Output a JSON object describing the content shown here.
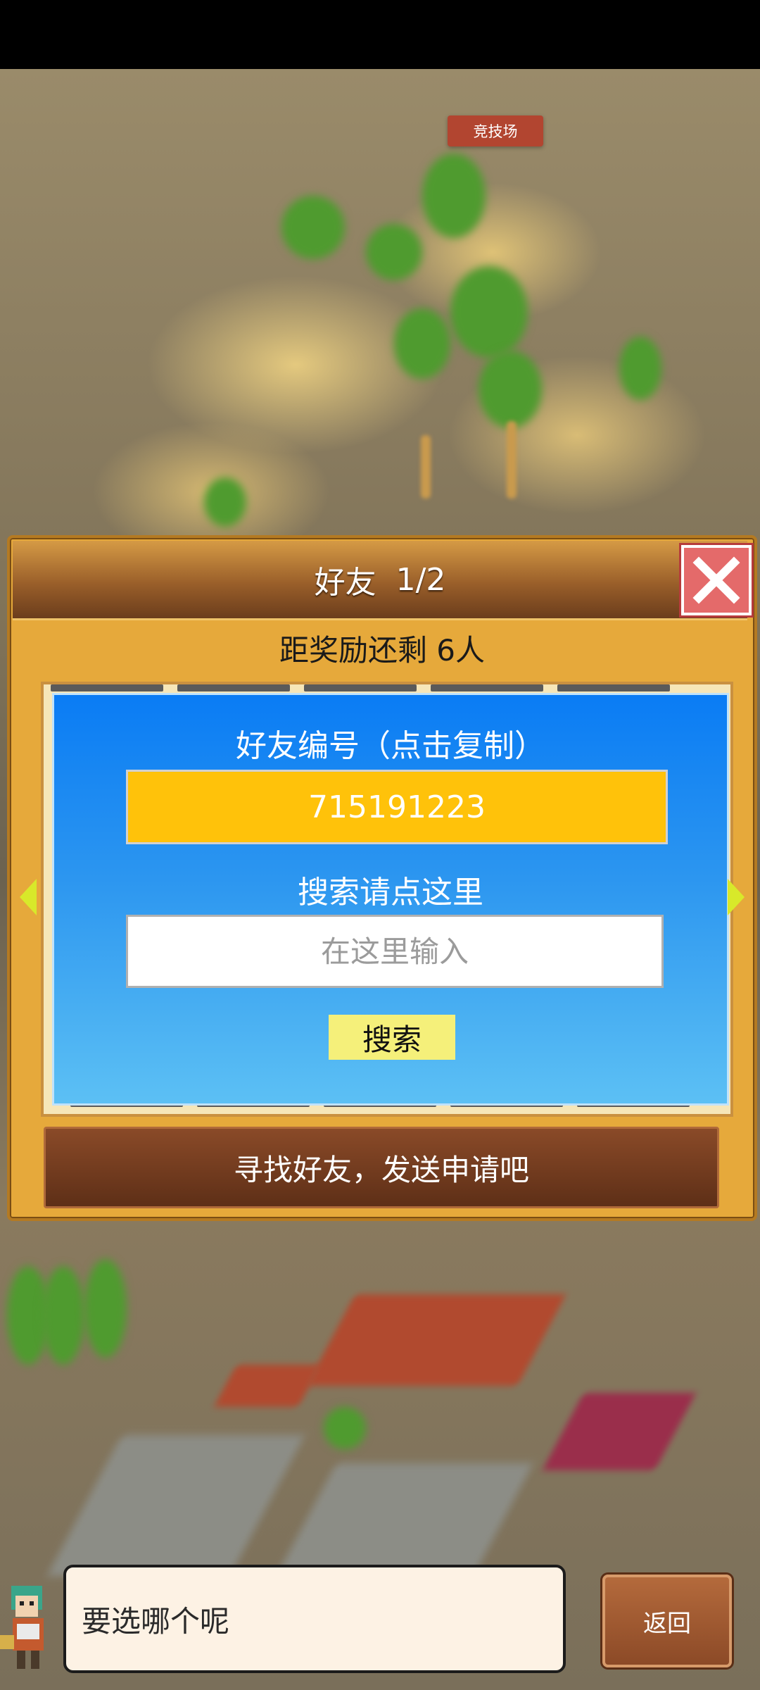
{
  "map": {
    "arena_label": "竞技场"
  },
  "dialog": {
    "title": "好友",
    "page": "1/2",
    "reward_text": "距奖励还剩 6人",
    "friend_code_label": "好友编号（点击复制）",
    "friend_code": "715191223",
    "search_label": "搜索请点这里",
    "search_placeholder": "在这里输入",
    "search_button": "搜索",
    "find_friends_button": "寻找好友，发送申请吧"
  },
  "bottom": {
    "speech": "要选哪个呢",
    "back_button": "返回"
  },
  "colors": {
    "dialog_bg": "#e6a93b",
    "panel_blue": "#0a7cf4",
    "code_bg": "#ffc20a",
    "search_button_bg": "#f5f07a",
    "close_red": "#e46a6a",
    "find_button_bg": "#6b3419"
  },
  "icons": [
    "close-icon",
    "arrow-left-icon",
    "arrow-right-icon",
    "character-avatar"
  ]
}
